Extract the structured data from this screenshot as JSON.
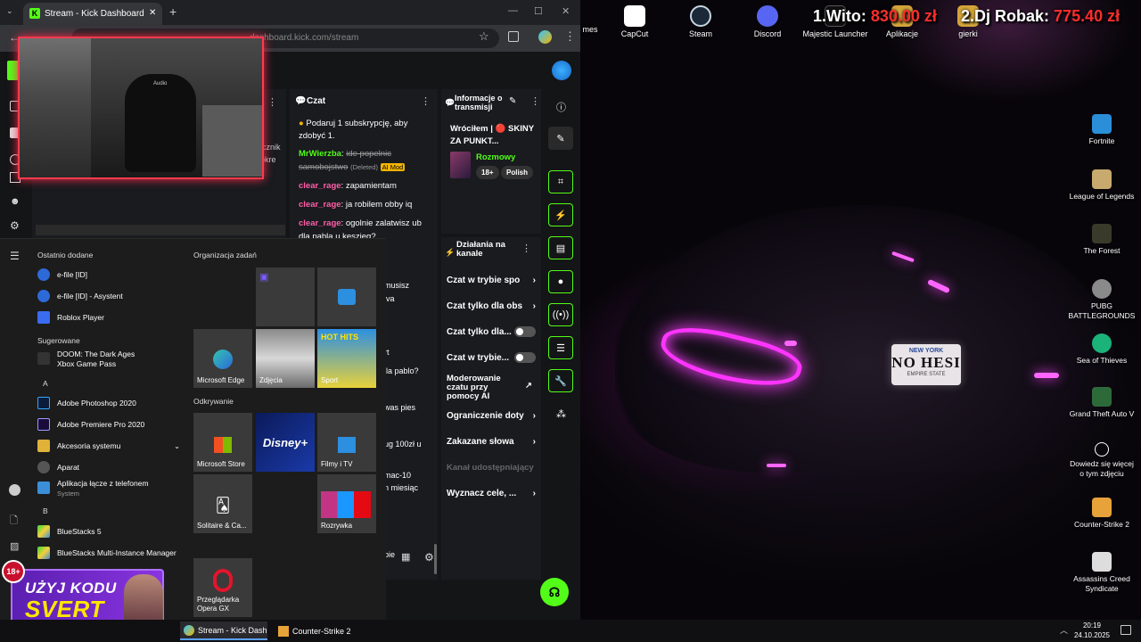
{
  "browser": {
    "tab_title": "Stream - Kick Dashboard",
    "url": "dashboard.kick.com/stream",
    "window_controls": {
      "minimize": "—",
      "maximize": "☐",
      "close": "✕"
    }
  },
  "webcam_overlay": {
    "caption": "Audio"
  },
  "behind_panel_text": {
    "a": "icznik",
    "b": "bkre"
  },
  "chat": {
    "title": "Czat",
    "promo": "Podaruj 1 subskrypcję, aby zdobyć 1.",
    "messages": [
      {
        "user": "MrWierzba",
        "text": "ide popelnic samobojstwo",
        "deleted": "(Deleted)",
        "badge": "AI Mod"
      },
      {
        "user": "clear_rage",
        "text": "zapamientam"
      },
      {
        "user": "clear_rage",
        "text": "ja robilem obby iq"
      },
      {
        "user": "clear_rage",
        "text": "ogolnie zalatwisz ub dla pabla u keszieg?"
      }
    ],
    "partial_lines": [
      "musisz",
      "iva",
      "rt",
      "lla pablo?",
      "was pies",
      "ug 100zł u",
      "mac-10",
      "n miesiąc",
      "pie"
    ]
  },
  "stream_info": {
    "title": "Informacje o transmisji",
    "stream_title": "Wróciłem | 🔴 SKINY ZA PUNKT...",
    "category": "Rozmowy",
    "tags": [
      "18+",
      "Polish"
    ]
  },
  "actions": {
    "title": "Działania na kanale",
    "items": [
      {
        "label": "Czat w trybie spo",
        "type": "arrow"
      },
      {
        "label": "Czat tylko dla obs",
        "type": "arrow"
      },
      {
        "label": "Czat tylko dla...",
        "type": "toggle"
      },
      {
        "label": "Czat w trybie...",
        "type": "toggle"
      },
      {
        "label": "Moderowanie czatu przy pomocy AI",
        "type": "external"
      },
      {
        "label": "Ograniczenie doty",
        "type": "arrow"
      },
      {
        "label": "Zakazane słowa",
        "type": "arrow"
      },
      {
        "label": "Kanał udostępniający",
        "type": "disabled"
      },
      {
        "label": "Wyznacz cele, ...",
        "type": "arrow"
      }
    ]
  },
  "start_menu": {
    "recent_header": "Ostatnio dodane",
    "recent": [
      "e-file [ID]",
      "e-file [ID] - Asystent",
      "Roblox Player"
    ],
    "suggested_header": "Sugerowane",
    "suggested": [
      "DOOM: The Dark Ages",
      "Xbox Game Pass"
    ],
    "letter_a": "A",
    "apps_a": [
      "Adobe Photoshop 2020",
      "Adobe Premiere Pro 2020",
      "Akcesoria systemu",
      "Aparat",
      "Aplikacja łącze z telefonem"
    ],
    "apps_a_sub": "System",
    "letter_b": "B",
    "apps_b": [
      "BlueStacks 5",
      "BlueStacks Multi-Instance Manager"
    ],
    "tiles_header_1": "Organizacja zadań",
    "tiles_header_2": "Odkrywanie",
    "tiles": {
      "edge": "Microsoft Edge",
      "zdjecia": "Zdjęcia",
      "sport": "Sport",
      "hothits": "HOT HITS",
      "store": "Microsoft Store",
      "disney": "Disney+",
      "filmy": "Filmy i TV",
      "solitaire": "Solitaire & Ca...",
      "rozrywka": "Rozrywka",
      "opera": "Przeglądarka Opera GX"
    }
  },
  "promo": {
    "line1": "UŻYJ KODU",
    "line2": "SVERT",
    "age": "18+"
  },
  "taskbar": {
    "items": [
      "Stream - Kick Dash...",
      "Counter-Strike 2"
    ],
    "time": "20:19",
    "date": "24.10.2025"
  },
  "desktop": {
    "top_icons": [
      "CapCut",
      "Steam",
      "Discord",
      "Majestic Launcher",
      "Aplikacje",
      "gierki"
    ],
    "partial_left": "mes",
    "right_icons": [
      "Fortnite",
      "League of Legends",
      "The Forest",
      "PUBG BATTLEGROUNDS",
      "Sea of Thieves",
      "Grand Theft Auto V",
      "Dowiedz się więcej o tym zdjęciu",
      "Counter-Strike 2",
      "Assassins Creed Syndicate"
    ],
    "donors": [
      {
        "rank": "1.",
        "name": "Wito:",
        "amount": "830.00 zł"
      },
      {
        "rank": "2.",
        "name": "Dj Robak:",
        "amount": "775.40 zł"
      }
    ],
    "plate": {
      "top": "NEW YORK",
      "main": "NO HESI",
      "bottom": "EMPIRE STATE"
    }
  },
  "colors": {
    "kick_green": "#53fc18",
    "neon": "#ff35ff",
    "donor_red": "#ff2d2d",
    "webcam_border": "#ff3b4e"
  }
}
